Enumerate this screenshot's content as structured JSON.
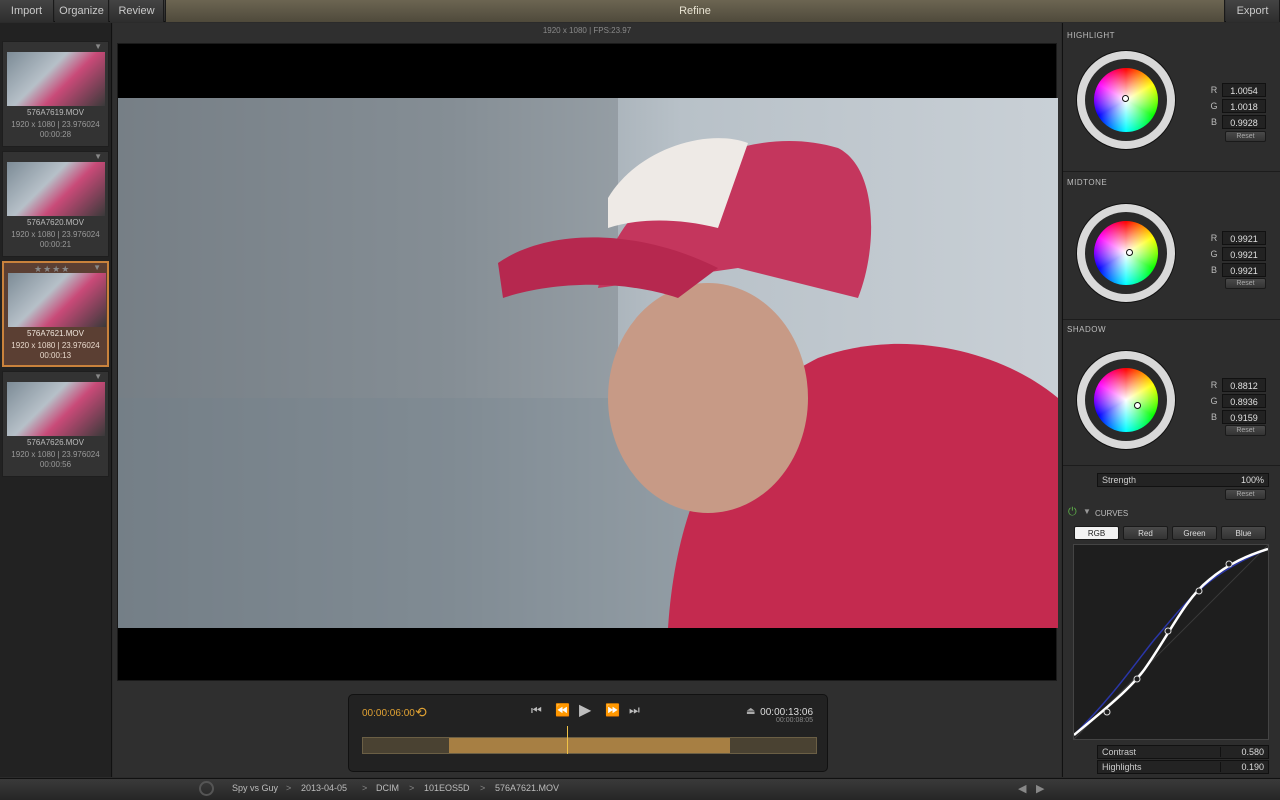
{
  "toolbar": {
    "import": "Import",
    "organize": "Organize",
    "review": "Review",
    "refine": "Refine",
    "export": "Export"
  },
  "viewer": {
    "info": "1920 x 1080 | FPS:23.97"
  },
  "clips": [
    {
      "name": "576A7619.MOV",
      "res": "1920 x 1080 | 23.976024",
      "dur": "00:00:28",
      "stars": "",
      "selected": false
    },
    {
      "name": "576A7620.MOV",
      "res": "1920 x 1080 | 23.976024",
      "dur": "00:00:21",
      "stars": "",
      "selected": false
    },
    {
      "name": "576A7621.MOV",
      "res": "1920 x 1080 | 23.976024",
      "dur": "00:00:13",
      "stars": "★★★★",
      "selected": true
    },
    {
      "name": "576A7626.MOV",
      "res": "1920 x 1080 | 23.976024",
      "dur": "00:00:56",
      "stars": "",
      "selected": false
    }
  ],
  "transport": {
    "timecode_current": "00:00:06:00",
    "timecode_total": "00:00:13:06",
    "timecode_sub": "00:00:08:05",
    "loop_icon": "loop-icon",
    "progress": 0.45,
    "in_point": 0.19,
    "out_point": 0.81
  },
  "color": {
    "highlight": {
      "title": "HIGHLIGHT",
      "r": "1.0054",
      "g": "1.0018",
      "b": "0.9928",
      "reset": "Reset"
    },
    "midtone": {
      "title": "MIDTONE",
      "r": "0.9921",
      "g": "0.9921",
      "b": "0.9921",
      "reset": "Reset"
    },
    "shadow": {
      "title": "SHADOW",
      "r": "0.8812",
      "g": "0.8936",
      "b": "0.9159",
      "reset": "Reset"
    },
    "labels": {
      "r": "R",
      "g": "G",
      "b": "B"
    }
  },
  "strength": {
    "label": "Strength",
    "value": "100%",
    "reset": "Reset"
  },
  "curves": {
    "title": "CURVES",
    "tabs": [
      "RGB",
      "Red",
      "Green",
      "Blue"
    ],
    "active_tab": "RGB",
    "contrast_label": "Contrast",
    "contrast": "0.580",
    "highlights_label": "Highlights",
    "highlights": "0.190"
  },
  "breadcrumb": [
    "Spy vs Guy",
    "2013-04-05",
    "DCIM",
    "101EOS5D",
    "576A7621.MOV"
  ],
  "colors": {
    "accent": "#e1a233",
    "refine_bg": "#5d5747",
    "selected_border": "#c9823c"
  }
}
